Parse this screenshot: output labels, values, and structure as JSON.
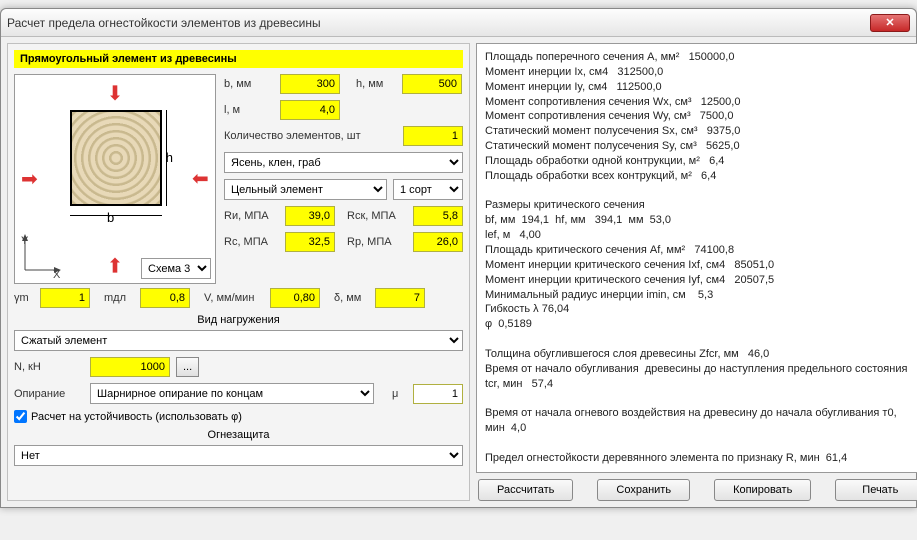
{
  "window_title": "Расчет предела огнестойкости элементов из древесины",
  "section_title": "Прямоугольный элемент из древесины",
  "labels": {
    "b": "b, мм",
    "h": "h, мм",
    "l": "l, м",
    "qty": "Количество элементов, шт",
    "Ri": "Rи, МПА",
    "Rsk": "Rск, МПА",
    "Rc": "Rс, МПА",
    "Rp": "Rр, МПА",
    "gm": "γm",
    "mdl": "mдл",
    "V": "V, мм/мин",
    "delta": "δ, мм",
    "load_header": "Вид нагружения",
    "N": "N, кН",
    "support": "Опирание",
    "mu": "μ",
    "stability": "Расчет на устойчивость (использовать φ)",
    "fire_header": "Огнезащита",
    "scheme": "Схема 3"
  },
  "values": {
    "b": "300",
    "h": "500",
    "l": "4,0",
    "qty": "1",
    "Ri": "39,0",
    "Rsk": "5,8",
    "Rc": "32,5",
    "Rp": "26,0",
    "gm": "1",
    "mdl": "0,8",
    "V": "0,80",
    "delta": "7",
    "N": "1000",
    "mu": "1"
  },
  "combos": {
    "wood": "Ясень, клен, граб",
    "solid": "Цельный элемент",
    "grade": "1 сорт",
    "load": "Сжатый элемент",
    "support": "Шарнирное опирание по концам",
    "fire": "Нет"
  },
  "diagram": {
    "b": "b",
    "h": "h"
  },
  "buttons": {
    "calc": "Рассчитать",
    "save": "Сохранить",
    "copy": "Копировать",
    "print": "Печать",
    "more": "..."
  },
  "output_text": "Площадь поперечного сечения A, мм²   150000,0\nМомент инерции Ix, см4   312500,0\nМомент инерции Iy, см4   112500,0\nМомент сопротивления сечения Wx, см³   12500,0\nМомент сопротивления сечения Wy, см³   7500,0\nСтатический момент полусечения Sx, см³   9375,0\nСтатический момент полусечения Sy, см³   5625,0\nПлощадь обработки одной контрукции, м²   6,4\nПлощадь обработки всех контрукций, м²   6,4\n\nРазмеры критического сечения\nbf, мм  194,1  hf, мм   394,1  мм  53,0\nlef, м   4,00\nПлощадь критического сечения Af, мм²   74100,8\nМомент инерции критического сечения Ixf, см4   85051,0\nМомент инерции критического сечения Iyf, см4   20507,5\nМинимальный радиус инерции imin, см    5,3\nГибкость λ 76,04\nφ  0,5189\n\nТолщина обуглившегося слоя древесины Zfcr, мм   46,0\nВремя от начало обугливания  древесины до наступления предельного состояния tcr, мин   57,4\n\nВремя от начала огневого воздействия на древесину до начала обугливания т0, мин  4,0\n\nПредел огнестойкости деревянного элемента по признаку R, мин  61,4"
}
